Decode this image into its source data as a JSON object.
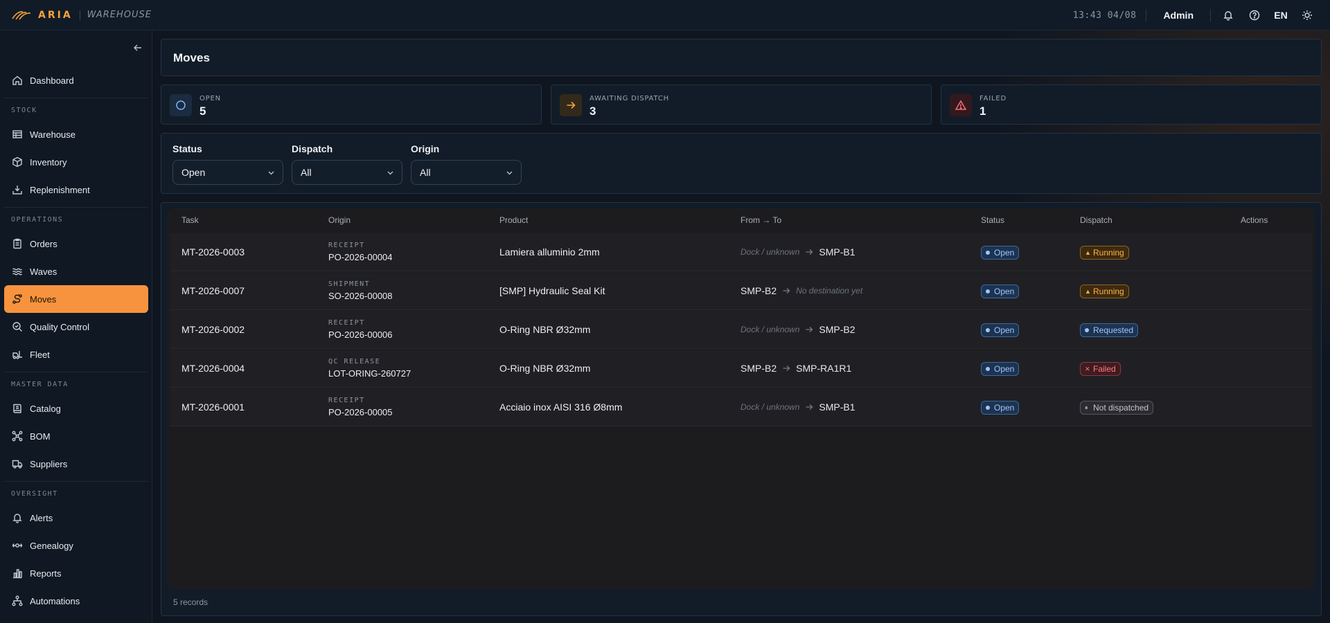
{
  "app": {
    "name": "ARIA",
    "module": "WAREHOUSE"
  },
  "topbar": {
    "clock": "13:43 04/08",
    "user": "Admin",
    "lang": "EN"
  },
  "sidebar": {
    "top_items": [
      {
        "label": "Dashboard",
        "icon": "home-icon"
      }
    ],
    "sections": [
      {
        "title": "STOCK",
        "items": [
          {
            "label": "Warehouse",
            "icon": "warehouse-icon"
          },
          {
            "label": "Inventory",
            "icon": "box-icon"
          },
          {
            "label": "Replenishment",
            "icon": "tray-download-icon"
          }
        ]
      },
      {
        "title": "OPERATIONS",
        "items": [
          {
            "label": "Orders",
            "icon": "clipboard-icon"
          },
          {
            "label": "Waves",
            "icon": "waves-icon"
          },
          {
            "label": "Moves",
            "icon": "route-icon",
            "active": true
          },
          {
            "label": "Quality Control",
            "icon": "magnifier-check-icon"
          },
          {
            "label": "Fleet",
            "icon": "forklift-icon"
          }
        ]
      },
      {
        "title": "MASTER DATA",
        "items": [
          {
            "label": "Catalog",
            "icon": "book-icon"
          },
          {
            "label": "BOM",
            "icon": "network-icon"
          },
          {
            "label": "Suppliers",
            "icon": "truck-icon"
          }
        ]
      },
      {
        "title": "OVERSIGHT",
        "items": [
          {
            "label": "Alerts",
            "icon": "bell-icon"
          },
          {
            "label": "Genealogy",
            "icon": "lineage-icon"
          },
          {
            "label": "Reports",
            "icon": "bar-chart-icon"
          },
          {
            "label": "Automations",
            "icon": "workflow-icon"
          }
        ]
      }
    ]
  },
  "page": {
    "title": "Moves"
  },
  "stats": [
    {
      "label": "OPEN",
      "value": "5",
      "icon": "circle-icon",
      "color": "#7fb2ff"
    },
    {
      "label": "AWAITING DISPATCH",
      "value": "3",
      "icon": "arrow-right-icon",
      "color": "#f5a23c"
    },
    {
      "label": "FAILED",
      "value": "1",
      "icon": "warning-triangle-icon",
      "color": "#ff6b73"
    }
  ],
  "filters": [
    {
      "label": "Status",
      "value": "Open"
    },
    {
      "label": "Dispatch",
      "value": "All"
    },
    {
      "label": "Origin",
      "value": "All"
    }
  ],
  "table": {
    "columns": [
      "Task",
      "Origin",
      "Product",
      "From → To",
      "Status",
      "Dispatch",
      "Actions"
    ],
    "rows": [
      {
        "task": "MT-2026-0003",
        "origin_type": "RECEIPT",
        "origin_ref": "PO-2026-00004",
        "product": "Lamiera alluminio 2mm",
        "from": "Dock / unknown",
        "from_muted": true,
        "to": "SMP-B1",
        "to_muted": false,
        "status": "Open",
        "dispatch": "Running",
        "dispatch_kind": "run"
      },
      {
        "task": "MT-2026-0007",
        "origin_type": "SHIPMENT",
        "origin_ref": "SO-2026-00008",
        "product": "[SMP] Hydraulic Seal Kit",
        "from": "SMP-B2",
        "from_muted": false,
        "to": "No destination yet",
        "to_muted": true,
        "status": "Open",
        "dispatch": "Running",
        "dispatch_kind": "run"
      },
      {
        "task": "MT-2026-0002",
        "origin_type": "RECEIPT",
        "origin_ref": "PO-2026-00006",
        "product": "O-Ring NBR Ø32mm",
        "from": "Dock / unknown",
        "from_muted": true,
        "to": "SMP-B2",
        "to_muted": false,
        "status": "Open",
        "dispatch": "Requested",
        "dispatch_kind": "req"
      },
      {
        "task": "MT-2026-0004",
        "origin_type": "QC RELEASE",
        "origin_ref": "LOT-ORING-260727",
        "product": "O-Ring NBR Ø32mm",
        "from": "SMP-B2",
        "from_muted": false,
        "to": "SMP-RA1R1",
        "to_muted": false,
        "status": "Open",
        "dispatch": "Failed",
        "dispatch_kind": "fail"
      },
      {
        "task": "MT-2026-0001",
        "origin_type": "RECEIPT",
        "origin_ref": "PO-2026-00005",
        "product": "Acciaio inox AISI 316 Ø8mm",
        "from": "Dock / unknown",
        "from_muted": true,
        "to": "SMP-B1",
        "to_muted": false,
        "status": "Open",
        "dispatch": "Not dispatched",
        "dispatch_kind": "nd"
      }
    ],
    "footer": "5 records"
  },
  "colors": {
    "accent": "#f7933e",
    "background": "#0f1620"
  }
}
